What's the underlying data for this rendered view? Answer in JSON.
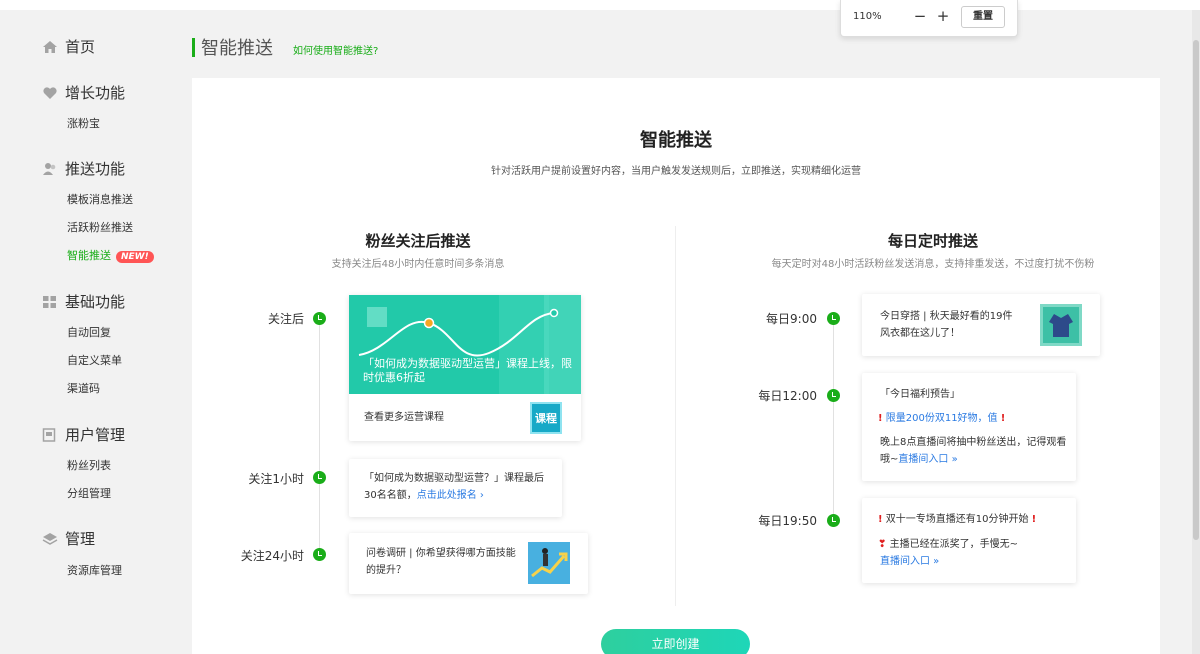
{
  "zoom": {
    "level": "110%",
    "minus": "−",
    "plus": "+",
    "reset": "重置"
  },
  "sidebar": {
    "home": "首页",
    "groups": [
      {
        "title": "增长功能",
        "icon": "heart-icon",
        "items": [
          "涨粉宝"
        ]
      },
      {
        "title": "推送功能",
        "icon": "users-icon",
        "items": [
          "模板消息推送",
          "活跃粉丝推送",
          "智能推送"
        ]
      },
      {
        "title": "基础功能",
        "icon": "grid-icon",
        "items": [
          "自动回复",
          "自定义菜单",
          "渠道码"
        ]
      },
      {
        "title": "用户管理",
        "icon": "id-card-icon",
        "items": [
          "粉丝列表",
          "分组管理"
        ]
      },
      {
        "title": "管理",
        "icon": "layers-icon",
        "items": [
          "资源库管理"
        ]
      }
    ],
    "new_badge": "NEW!"
  },
  "page": {
    "title": "智能推送",
    "help": "如何使用智能推送?"
  },
  "main": {
    "title": "智能推送",
    "subtitle": "针对活跃用户提前设置好内容，当用户触发发送规则后，立即推送，实现精细化运营",
    "left": {
      "title": "粉丝关注后推送",
      "subtitle": "支持关注后48小时内任意时间多条消息",
      "items": [
        {
          "label": "关注后",
          "promo": "「如何成为数据驱动型运营」课程上线，限时优惠6折起",
          "text": "查看更多运营课程",
          "thumb": "课程"
        },
        {
          "label": "关注1小时",
          "text": "「如何成为数据驱动型运营？」课程最后30名名额，",
          "link": "点击此处报名 ›"
        },
        {
          "label": "关注24小时",
          "text": "问卷调研 | 你希望获得哪方面技能的提升？"
        }
      ]
    },
    "right": {
      "title": "每日定时推送",
      "subtitle": "每天定时对48小时活跃粉丝发送消息，支持排重发送，不过度打扰不伤粉",
      "items": [
        {
          "label": "每日9:00",
          "text": "今日穿搭 | 秋天最好看的19件风衣都在这儿了！"
        },
        {
          "label": "每日12:00",
          "line1": "「今日福利预告」",
          "line2": "限量200份双11好物，值",
          "line3": "晚上8点直播间将抽中粉丝送出，记得观看哦~",
          "link": "直播间入口 »"
        },
        {
          "label": "每日19:50",
          "line1": "双十一专场直播还有10分钟开始",
          "line2": "主播已经在派奖了，手慢无~",
          "link": "直播间入口 »"
        }
      ]
    },
    "create_button": "立即创建"
  },
  "colors": {
    "accent": "#1aad19",
    "link": "#2a7ae2",
    "badge": "#ff5555",
    "button": "#2ecf9e"
  }
}
